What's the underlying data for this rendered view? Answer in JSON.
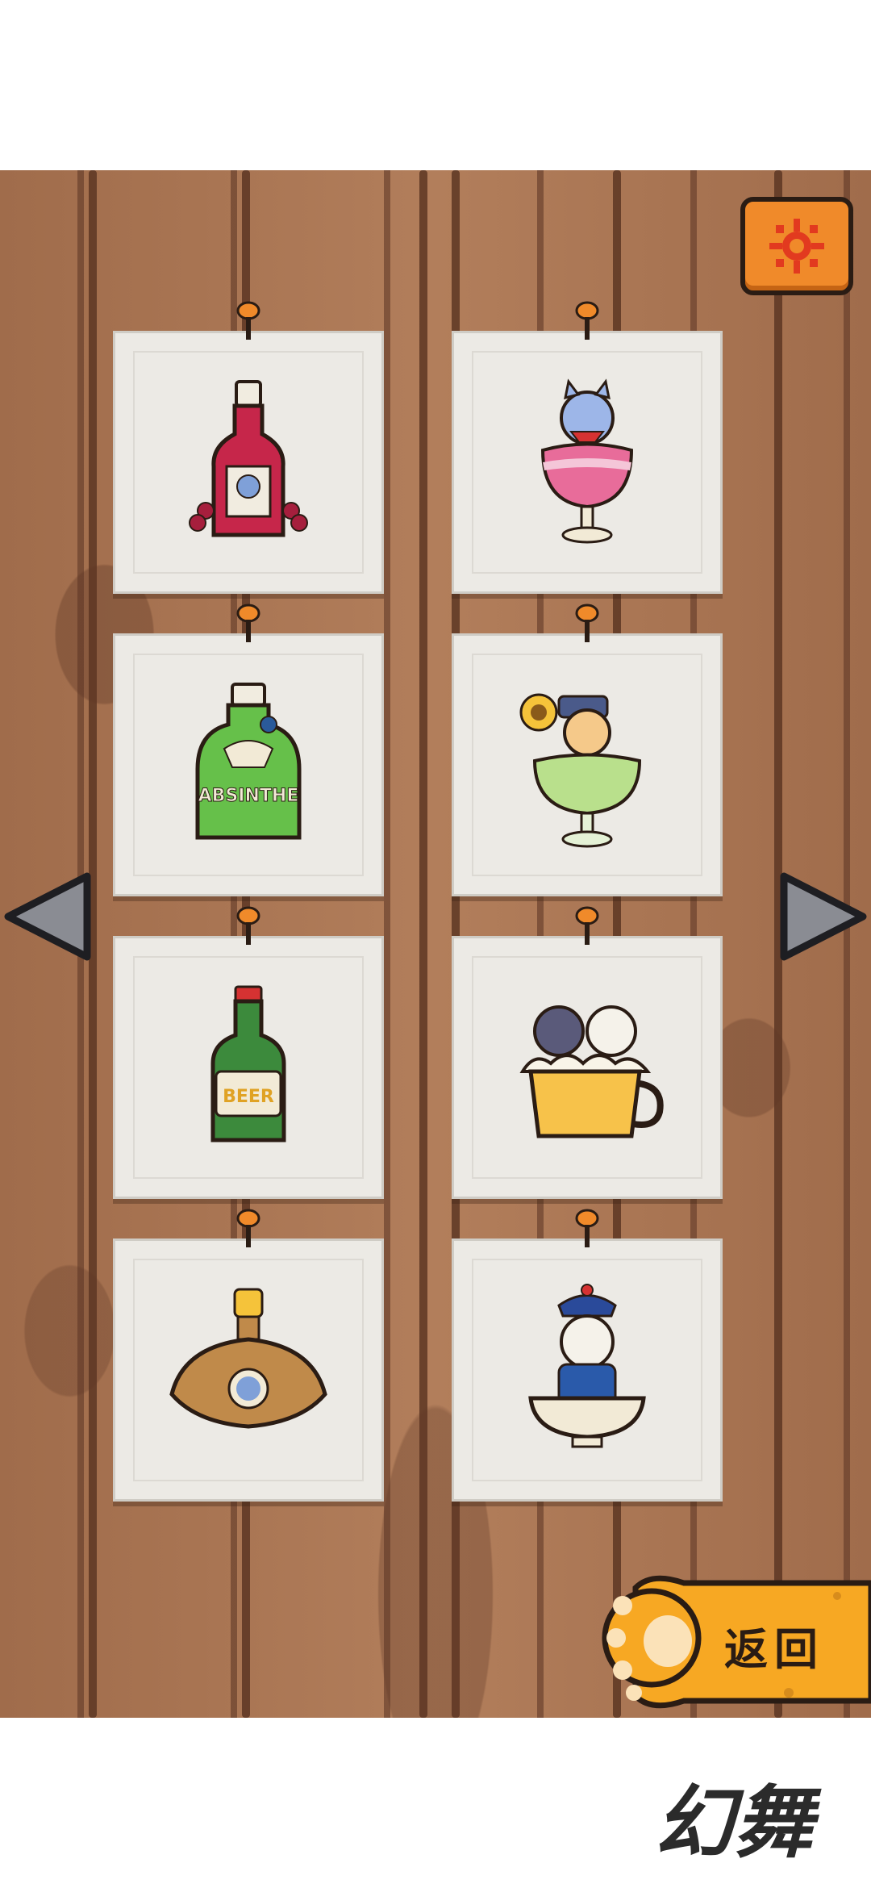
{
  "back_button": {
    "label": "返回"
  },
  "watermark": {
    "text": "幻舞"
  },
  "colors": {
    "wood": "#a06c4b",
    "wood_line": "#5d3623",
    "card": "#eceae5",
    "accent_orange": "#f08a2a",
    "paw_yellow": "#f7a823"
  },
  "icons": {
    "settings": "gear-icon",
    "prev": "arrow-left-icon",
    "next": "arrow-right-icon",
    "pin": "pushpin-icon"
  },
  "cards": [
    {
      "item": "red-wine-bottle"
    },
    {
      "item": "cat-in-wine-glass"
    },
    {
      "item": "absinthe-bottle",
      "text": "ABSINTHE"
    },
    {
      "item": "cat-in-absinthe-glass"
    },
    {
      "item": "beer-bottle",
      "text": "BEER"
    },
    {
      "item": "cats-in-beer-mug"
    },
    {
      "item": "baijiu-flask"
    },
    {
      "item": "cat-in-bowl"
    }
  ]
}
